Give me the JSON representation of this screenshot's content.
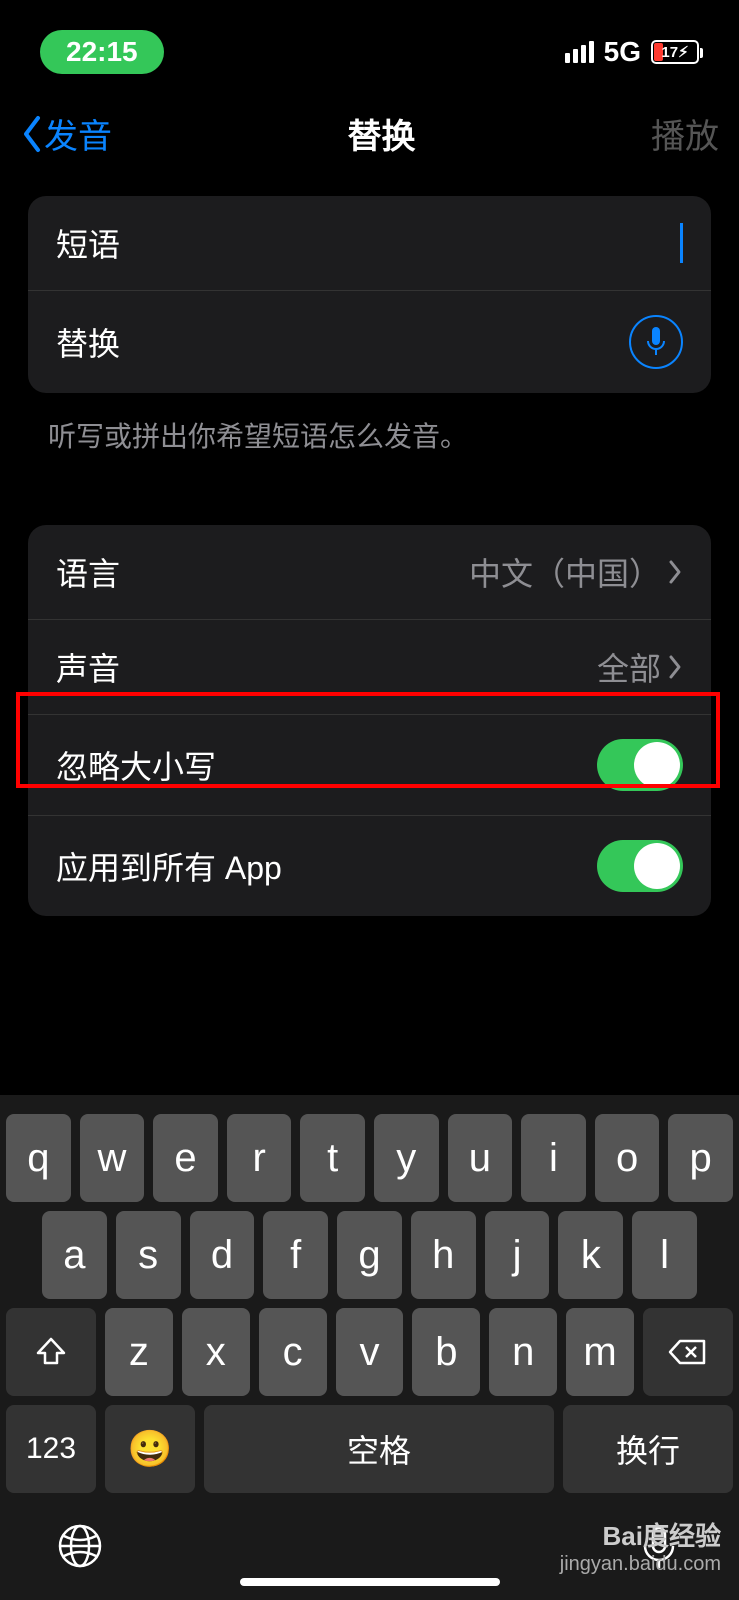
{
  "status": {
    "time": "22:15",
    "network": "5G",
    "battery_text": "17"
  },
  "nav": {
    "back": "发音",
    "title": "替换",
    "action": "播放"
  },
  "inputGroup": {
    "phrase_label": "短语",
    "replace_label": "替换",
    "helper": "听写或拼出你希望短语怎么发音。"
  },
  "settings": {
    "language_label": "语言",
    "language_value": "中文（中国）",
    "voice_label": "声音",
    "voice_value": "全部",
    "ignore_case_label": "忽略大小写",
    "apply_all_label": "应用到所有 App"
  },
  "keyboard": {
    "row1": [
      "q",
      "w",
      "e",
      "r",
      "t",
      "y",
      "u",
      "i",
      "o",
      "p"
    ],
    "row2": [
      "a",
      "s",
      "d",
      "f",
      "g",
      "h",
      "j",
      "k",
      "l"
    ],
    "row3": [
      "z",
      "x",
      "c",
      "v",
      "b",
      "n",
      "m"
    ],
    "numkey": "123",
    "space": "空格",
    "return": "换行"
  },
  "watermark": {
    "brand": "Bai度经验",
    "url": "jingyan.baidu.com"
  }
}
